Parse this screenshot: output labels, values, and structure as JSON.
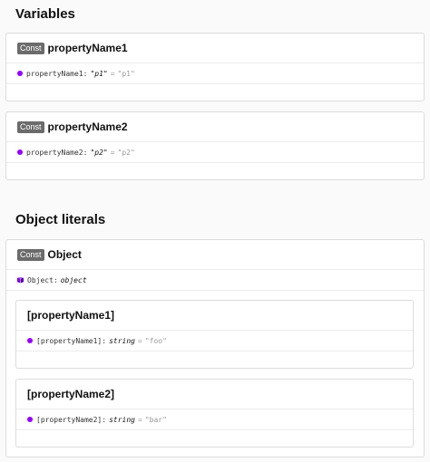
{
  "sections": {
    "variables_title": "Variables",
    "object_literals_title": "Object literals"
  },
  "variables": [
    {
      "badge": "Const",
      "title": "propertyName1",
      "sig_name": "propertyName1",
      "sig_type": "\"p1\"",
      "sig_eq": "=",
      "sig_value": "\"p1\""
    },
    {
      "badge": "Const",
      "title": "propertyName2",
      "sig_name": "propertyName2",
      "sig_type": "\"p2\"",
      "sig_eq": "=",
      "sig_value": "\"p2\""
    }
  ],
  "object_literal": {
    "badge": "Const",
    "title": "Object",
    "sig_name": "Object",
    "sig_type": "object",
    "members": [
      {
        "title": "[propertyName1]",
        "sig_name": "[propertyName1]",
        "sig_type": "string",
        "sig_eq": "=",
        "sig_value": "\"foo\""
      },
      {
        "title": "[propertyName2]",
        "sig_name": "[propertyName2]",
        "sig_type": "string",
        "sig_eq": "=",
        "sig_value": "\"bar\""
      }
    ]
  },
  "colors": {
    "property_dot": "#9600ff",
    "badge_bg": "#6b6b6b"
  },
  "icons": {
    "property": "purple-dot-icon",
    "object": "purple-cube-icon"
  }
}
